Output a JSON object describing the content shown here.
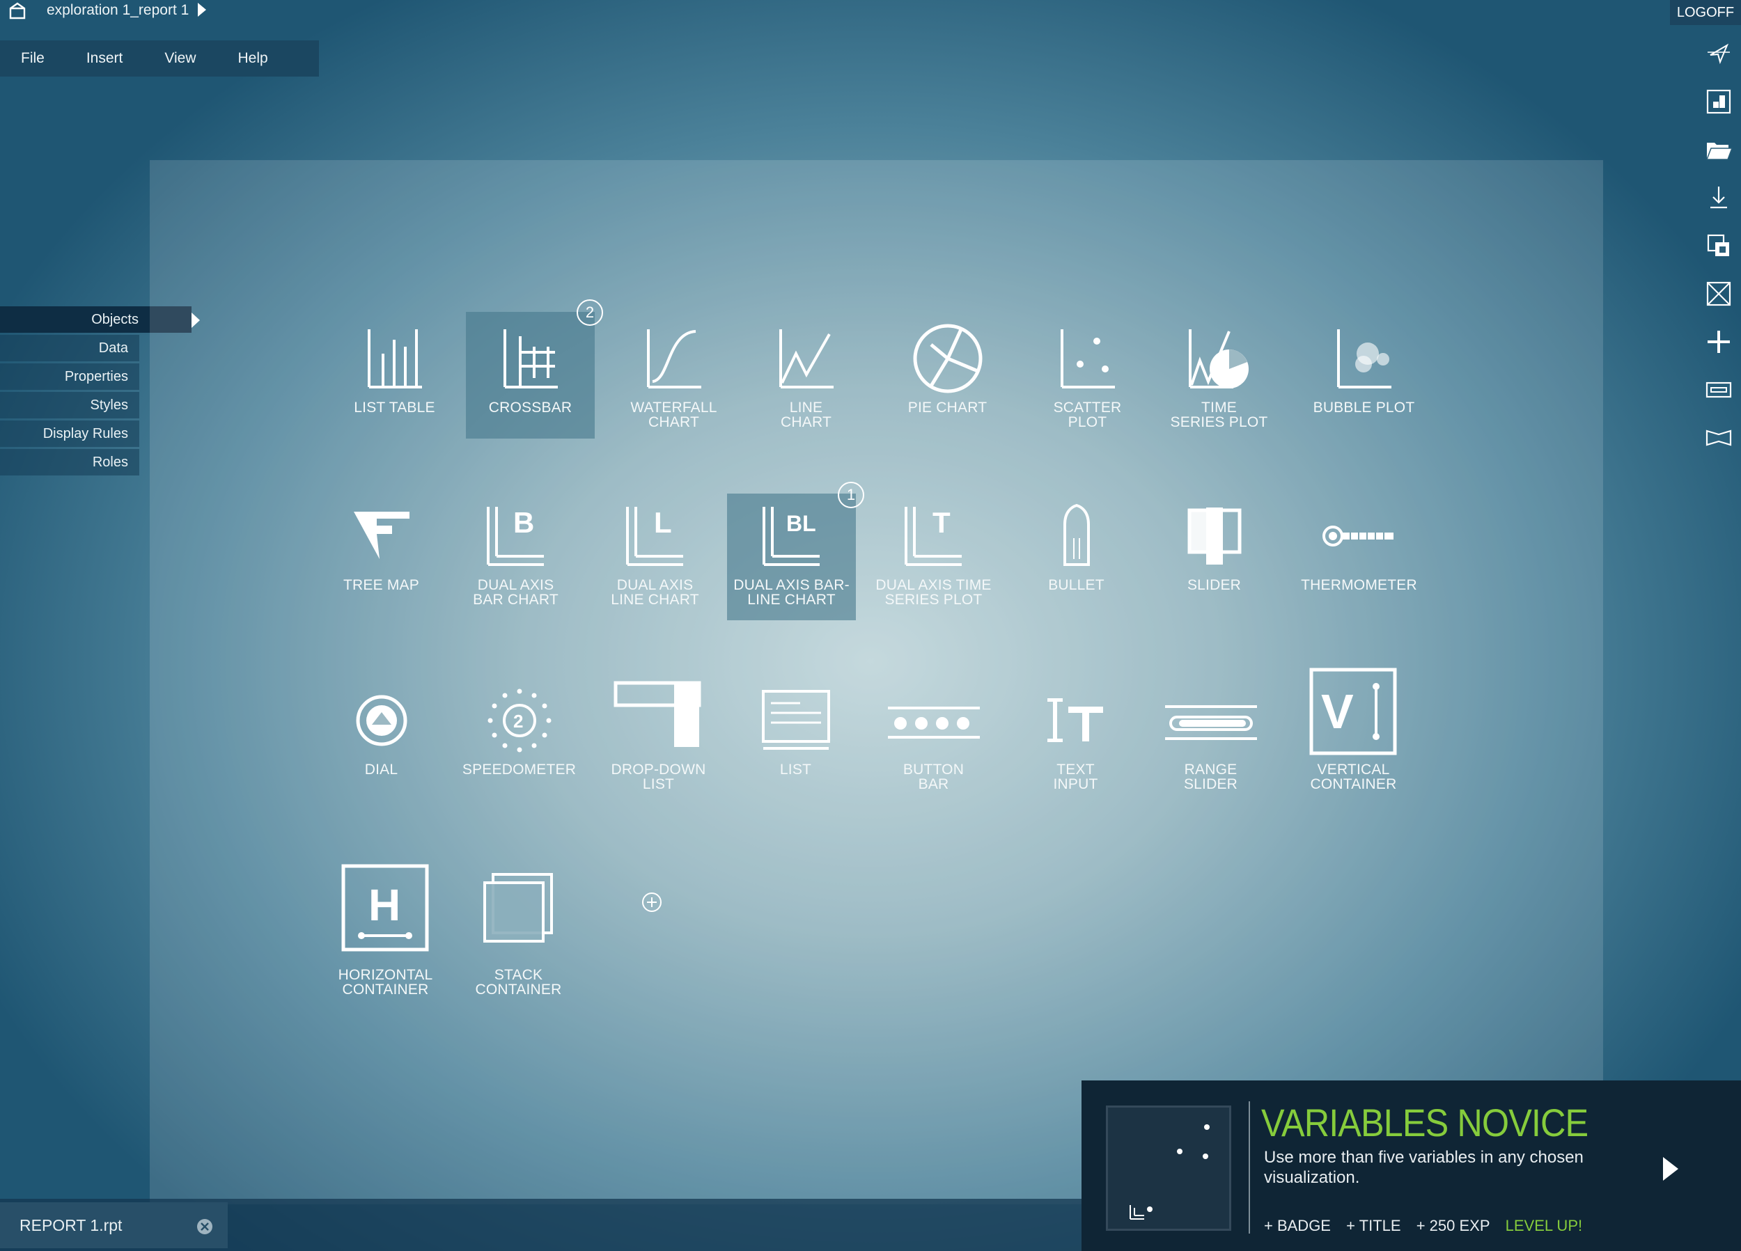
{
  "topbar": {
    "title": "exploration 1_report 1",
    "logoff": "LOGOFF"
  },
  "menu": [
    "File",
    "Insert",
    "View",
    "Help"
  ],
  "sidebar": [
    "Objects",
    "Data",
    "Properties",
    "Styles",
    "Display Rules",
    "Roles"
  ],
  "objects": [
    {
      "label": "LIST TABLE",
      "icon": "list-table-icon"
    },
    {
      "label": "CROSSBAR",
      "icon": "crossbar-icon",
      "selected": true,
      "badge": "2"
    },
    {
      "label": "WATERFALL\nCHART",
      "icon": "waterfall-chart-icon"
    },
    {
      "label": "LINE\nCHART",
      "icon": "line-chart-icon"
    },
    {
      "label": "PIE CHART",
      "icon": "pie-chart-icon"
    },
    {
      "label": "SCATTER\nPLOT",
      "icon": "scatter-plot-icon"
    },
    {
      "label": "TIME\nSERIES PLOT",
      "icon": "time-series-plot-icon"
    },
    {
      "label": "BUBBLE PLOT",
      "icon": "bubble-plot-icon"
    },
    {
      "label": "TREE MAP",
      "icon": "tree-map-icon"
    },
    {
      "label": "DUAL AXIS\nBAR CHART",
      "icon": "dual-axis-bar-chart-icon"
    },
    {
      "label": "DUAL AXIS\nLINE CHART",
      "icon": "dual-axis-line-chart-icon"
    },
    {
      "label": "DUAL AXIS BAR-\nLINE CHART",
      "icon": "dual-axis-bar-line-chart-icon",
      "selected": true,
      "badge": "1"
    },
    {
      "label": "DUAL AXIS TIME\nSERIES PLOT",
      "icon": "dual-axis-time-series-plot-icon"
    },
    {
      "label": "BULLET",
      "icon": "bullet-icon"
    },
    {
      "label": "SLIDER",
      "icon": "slider-icon"
    },
    {
      "label": "THERMOMETER",
      "icon": "thermometer-icon"
    },
    {
      "label": "DIAL",
      "icon": "dial-icon"
    },
    {
      "label": "SPEEDOMETER",
      "icon": "speedometer-icon"
    },
    {
      "label": "DROP-DOWN\nLIST",
      "icon": "drop-down-list-icon"
    },
    {
      "label": "LIST",
      "icon": "list-icon"
    },
    {
      "label": "BUTTON\nBAR",
      "icon": "button-bar-icon"
    },
    {
      "label": "TEXT\nINPUT",
      "icon": "text-input-icon"
    },
    {
      "label": "RANGE\nSLIDER",
      "icon": "range-slider-icon"
    },
    {
      "label": "VERTICAL\nCONTAINER",
      "icon": "vertical-container-icon"
    },
    {
      "label": "HORIZONTAL\nCONTAINER",
      "icon": "horizontal-container-icon"
    },
    {
      "label": "STACK\nCONTAINER",
      "icon": "stack-container-icon"
    }
  ],
  "icon_text": {
    "dab": "B",
    "dal": "L",
    "dabl": "BL",
    "dats": "T",
    "speed": "2",
    "vc": "V",
    "hc": "H"
  },
  "bottom": {
    "report": "REPORT 1.rpt"
  },
  "achievement": {
    "title": "VARIABLES NOVICE",
    "desc": "Use more than five variables in any chosen visualization.",
    "rewards": [
      "+ BADGE",
      "+ TITLE",
      "+ 250 EXP"
    ],
    "levelup": "LEVEL UP!"
  },
  "colors": {
    "accent": "#86cc3c",
    "bar": "#1b4761"
  }
}
